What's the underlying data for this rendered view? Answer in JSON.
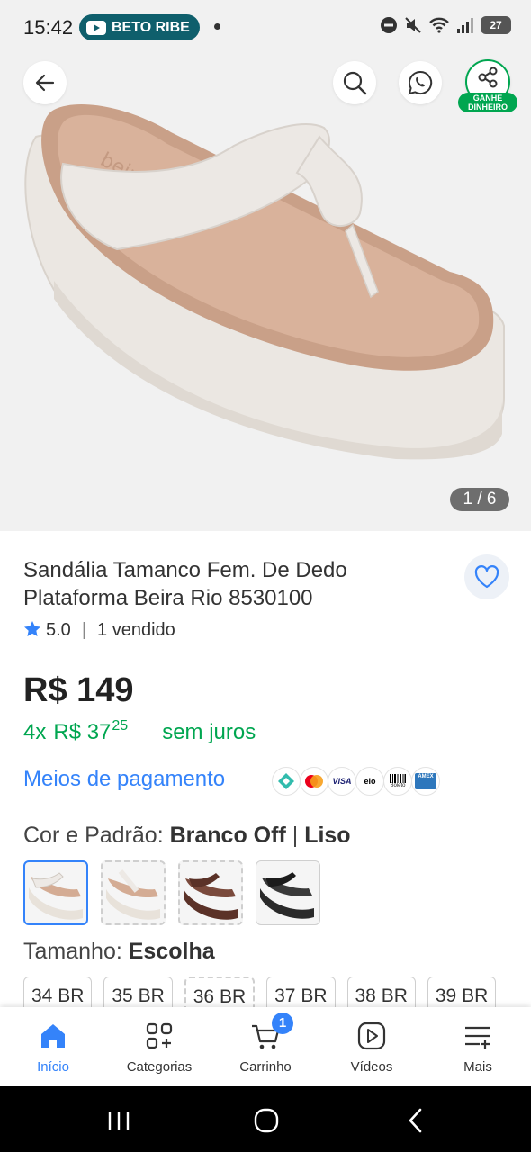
{
  "status_bar": {
    "time": "15:42",
    "channel_pill": "BETO RIBE",
    "battery": "27",
    "icons": [
      "do-not-disturb-icon",
      "mute-icon",
      "wifi-icon",
      "signal-icon",
      "battery-icon"
    ]
  },
  "gallery": {
    "counter": "1 / 6",
    "earn_badge_line1": "GANHE",
    "earn_badge_line2": "DINHEIRO",
    "icons": [
      "back-arrow-icon",
      "search-icon",
      "whatsapp-icon",
      "share-icon"
    ]
  },
  "product": {
    "title": "Sandália Tamanco Fem. De Dedo Plataforma Beira Rio 8530100",
    "rating": "5.0",
    "sold": "1 vendido",
    "price": "R$ 149",
    "installment_count": "4x",
    "installment_value": "R$ 37",
    "installment_cents": "25",
    "installment_note": "sem juros",
    "payment_link": "Meios de pagamento",
    "payment_methods": [
      "pix",
      "mastercard",
      "VISA",
      "elo",
      "Boleto",
      "AMEX"
    ]
  },
  "variations": {
    "color_label": "Cor e Padrão:",
    "color_value": "Branco Off",
    "pattern_sep": "|",
    "pattern_value": "Liso",
    "swatch_colors": [
      "#e8e2da",
      "#e8e2da",
      "#5b3228",
      "#2a2a2a"
    ],
    "size_label": "Tamanho:",
    "size_value": "Escolha",
    "sizes": [
      "34 BR",
      "35 BR",
      "36 BR",
      "37 BR",
      "38 BR",
      "39 BR"
    ]
  },
  "bottom_nav": {
    "items": [
      {
        "label": "Início",
        "icon": "home-icon"
      },
      {
        "label": "Categorias",
        "icon": "categories-icon"
      },
      {
        "label": "Carrinho",
        "icon": "cart-icon"
      },
      {
        "label": "Vídeos",
        "icon": "video-icon"
      },
      {
        "label": "Mais",
        "icon": "more-menu-icon"
      }
    ],
    "cart_count": "1"
  },
  "colors": {
    "accent_blue": "#3483fa",
    "green": "#00a650"
  }
}
